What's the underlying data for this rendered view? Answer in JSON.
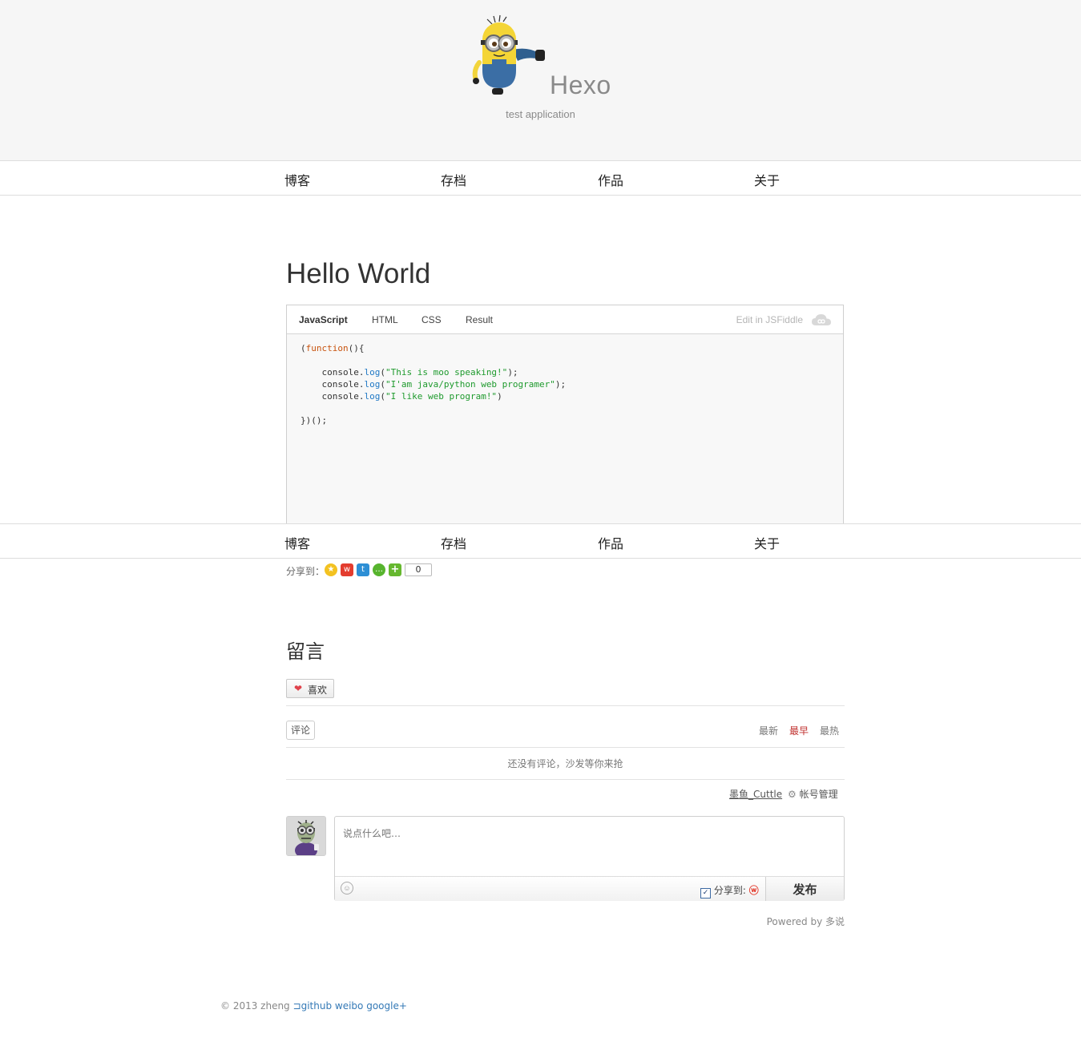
{
  "header": {
    "title": "Hexo",
    "subtitle": "test application"
  },
  "nav": {
    "items": [
      {
        "label": "博客"
      },
      {
        "label": "存档"
      },
      {
        "label": "作品"
      },
      {
        "label": "关于"
      }
    ]
  },
  "post": {
    "title": "Hello World"
  },
  "fiddle": {
    "tabs": [
      "JavaScript",
      "HTML",
      "CSS",
      "Result"
    ],
    "active_tab": "JavaScript",
    "edit_label": "Edit in JSFiddle",
    "code": [
      "(function(){",
      "",
      "    console.log(\"This is moo speaking!\");",
      "    console.log(\"I'am java/python web programer\");",
      "    console.log(\"I like web program!\")",
      "",
      "})();"
    ]
  },
  "share": {
    "label": "分享到：",
    "count": "0",
    "icons": [
      "qzone-icon",
      "weibo-icon",
      "tencent-weibo-icon",
      "wechat-icon",
      "more-share-icon"
    ]
  },
  "comments": {
    "title": "留言",
    "like_label": "喜欢",
    "tab_label": "评论",
    "order": {
      "newest": "最新",
      "oldest": "最早",
      "hottest": "最热",
      "active": "oldest"
    },
    "empty_message": "还没有评论，沙发等你来抢",
    "user_name": "墨鱼_Cuttle",
    "account_label": "帐号管理",
    "placeholder": "说点什么吧…",
    "sync_label": "分享到:",
    "submit_label": "发布",
    "powered_by": "Powered by 多说"
  },
  "footer": {
    "copyright": "© 2013 zheng",
    "links": [
      "github",
      "weibo",
      "google+"
    ]
  },
  "colors": {
    "header_bg": "#f6f6f6",
    "title_gray": "#8a8a8a",
    "link_blue": "#3479b6",
    "active_order": "#c0312f",
    "code_keyword": "#c8530e",
    "code_function": "#1f78c5",
    "code_string": "#1e9a2d"
  }
}
